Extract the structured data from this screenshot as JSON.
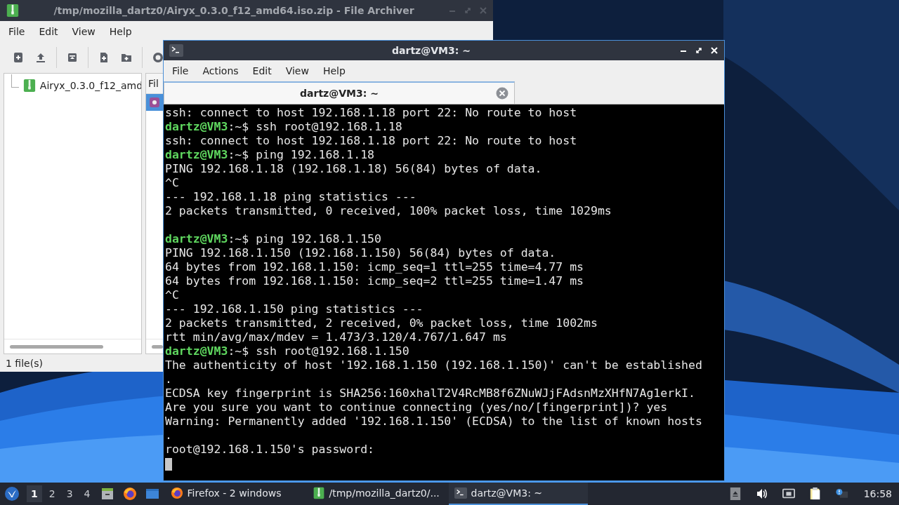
{
  "archiver": {
    "title": "/tmp/mozilla_dartz0/Airyx_0.3.0_f12_amd64.iso.zip - File Archiver",
    "menu": [
      "File",
      "Edit",
      "View",
      "Help"
    ],
    "tree": [
      {
        "label": "Airyx_0.3.0_f12_amd"
      }
    ],
    "list_header": "Fil",
    "status": "1 file(s)"
  },
  "terminal": {
    "title": "dartz@VM3: ~",
    "menu": [
      "File",
      "Actions",
      "Edit",
      "View",
      "Help"
    ],
    "tabs": [
      {
        "label": "dartz@VM3: ~",
        "selected": true
      }
    ],
    "lines": [
      {
        "kind": "output",
        "text": "ssh: connect to host 192.168.1.18 port 22: No route to host"
      },
      {
        "kind": "prompt",
        "user": "dartz@VM3",
        "text": ":~$ ssh root@192.168.1.18"
      },
      {
        "kind": "output",
        "text": "ssh: connect to host 192.168.1.18 port 22: No route to host"
      },
      {
        "kind": "prompt",
        "user": "dartz@VM3",
        "text": ":~$ ping 192.168.1.18"
      },
      {
        "kind": "output",
        "text": "PING 192.168.1.18 (192.168.1.18) 56(84) bytes of data."
      },
      {
        "kind": "output",
        "text": "^C"
      },
      {
        "kind": "output",
        "text": "--- 192.168.1.18 ping statistics ---"
      },
      {
        "kind": "output",
        "text": "2 packets transmitted, 0 received, 100% packet loss, time 1029ms"
      },
      {
        "kind": "blank"
      },
      {
        "kind": "prompt",
        "user": "dartz@VM3",
        "text": ":~$ ping 192.168.1.150"
      },
      {
        "kind": "output",
        "text": "PING 192.168.1.150 (192.168.1.150) 56(84) bytes of data."
      },
      {
        "kind": "output",
        "text": "64 bytes from 192.168.1.150: icmp_seq=1 ttl=255 time=4.77 ms"
      },
      {
        "kind": "output",
        "text": "64 bytes from 192.168.1.150: icmp_seq=2 ttl=255 time=1.47 ms"
      },
      {
        "kind": "output",
        "text": "^C"
      },
      {
        "kind": "output",
        "text": "--- 192.168.1.150 ping statistics ---"
      },
      {
        "kind": "output",
        "text": "2 packets transmitted, 2 received, 0% packet loss, time 1002ms"
      },
      {
        "kind": "output",
        "text": "rtt min/avg/max/mdev = 1.473/3.120/4.767/1.647 ms"
      },
      {
        "kind": "prompt",
        "user": "dartz@VM3",
        "text": ":~$ ssh root@192.168.1.150"
      },
      {
        "kind": "output",
        "text": "The authenticity of host '192.168.1.150 (192.168.1.150)' can't be established"
      },
      {
        "kind": "output",
        "text": "."
      },
      {
        "kind": "output",
        "text": "ECDSA key fingerprint is SHA256:160xhalT2V4RcMB8f6ZNuWJjFAdsnMzXHfN7Ag1erkI."
      },
      {
        "kind": "output",
        "text": "Are you sure you want to continue connecting (yes/no/[fingerprint])? yes"
      },
      {
        "kind": "output",
        "text": "Warning: Permanently added '192.168.1.150' (ECDSA) to the list of known hosts"
      },
      {
        "kind": "output",
        "text": "."
      },
      {
        "kind": "output",
        "text": "root@192.168.1.150's password:"
      },
      {
        "kind": "cursor"
      }
    ]
  },
  "taskbar": {
    "workspaces": [
      {
        "label": "1",
        "selected": true
      },
      {
        "label": "2",
        "selected": false
      },
      {
        "label": "3",
        "selected": false
      },
      {
        "label": "4",
        "selected": false
      }
    ],
    "tasks": [
      {
        "label": "Firefox - 2 windows",
        "kind": "firefox",
        "selected": false
      },
      {
        "label": "/tmp/mozilla_dartz0/...",
        "kind": "archive",
        "selected": false
      },
      {
        "label": "dartz@VM3: ~",
        "kind": "terminal",
        "selected": true
      }
    ],
    "clock": "16:58"
  }
}
